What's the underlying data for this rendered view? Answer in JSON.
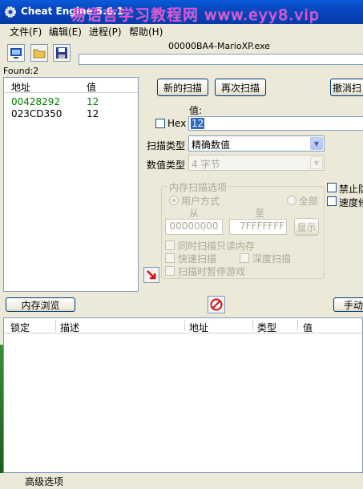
{
  "titlebar": {
    "title": "Cheat Engine 5.6.1",
    "watermark": "易语言学习教程网 www.eyy8.vip"
  },
  "menu": [
    {
      "label": "文件(F)"
    },
    {
      "label": "编辑(E)"
    },
    {
      "label": "进程(P)"
    },
    {
      "label": "帮助(H)"
    }
  ],
  "toolbar": {
    "process_name": "00000BA4-MarioXP.exe",
    "icons": [
      "select-process-icon",
      "open-file-icon",
      "save-file-icon"
    ]
  },
  "found_label": "Found:2",
  "results": {
    "headers": {
      "address": "地址",
      "value": "值"
    },
    "rows": [
      {
        "address": "00428292",
        "value": "12",
        "color": "#008000"
      },
      {
        "address": "023CD350",
        "value": "12",
        "color": "#000000"
      }
    ]
  },
  "scan": {
    "new_scan": "新的扫描",
    "next_scan": "再次扫描",
    "undo_scan": "撤消扫",
    "value_label": "值:",
    "hex_label": "Hex",
    "value_input": "12",
    "scan_type_label": "扫描类型",
    "scan_type_value": "精确数值",
    "value_type_label": "数值类型",
    "value_type_value": "4 字节"
  },
  "memory_options": {
    "title": "内存扫描选项",
    "user_mode": "用户方式",
    "all": "全部",
    "from_label": "从",
    "to_label": "至",
    "from_value": "00000000",
    "to_value": "7FFFFFFF",
    "show_button": "显示",
    "readonly_memory": "同时扫描只读内存",
    "fast_scan": "快速扫描",
    "deep_scan": "深度扫描",
    "pause_game": "扫描时暂停游戏"
  },
  "side_options": {
    "disable": "禁止防",
    "speed": "速度修"
  },
  "buttons": {
    "memory_view": "内存浏览",
    "manual_add": "手动"
  },
  "address_list": {
    "headers": [
      "锁定",
      "描述",
      "地址",
      "类型",
      "值"
    ]
  },
  "bottom": {
    "advanced": "高级选项"
  }
}
